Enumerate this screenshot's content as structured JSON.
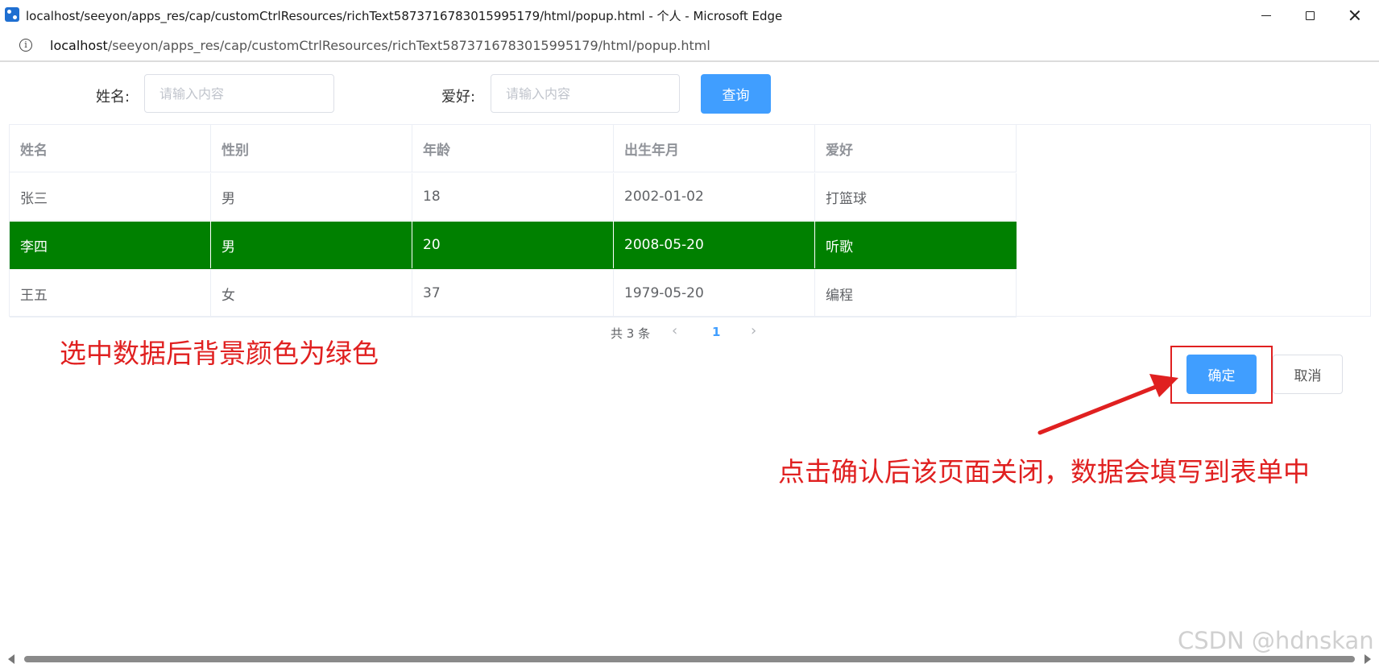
{
  "window": {
    "title": "localhost/seeyon/apps_res/cap/customCtrlResources/richText5873716783015995179/html/popup.html - 个人 - Microsoft Edge"
  },
  "address": {
    "host": "localhost",
    "path": "/seeyon/apps_res/cap/customCtrlResources/richText5873716783015995179/html/popup.html"
  },
  "search": {
    "name_label": "姓名:",
    "name_placeholder": "请输入内容",
    "hobby_label": "爱好:",
    "hobby_placeholder": "请输入内容",
    "query_label": "查询"
  },
  "table": {
    "columns": [
      "姓名",
      "性别",
      "年龄",
      "出生年月",
      "爱好"
    ],
    "rows": [
      [
        "张三",
        "男",
        "18",
        "2002-01-02",
        "打篮球"
      ],
      [
        "李四",
        "男",
        "20",
        "2008-05-20",
        "听歌"
      ],
      [
        "王五",
        "女",
        "37",
        "1979-05-20",
        "编程"
      ]
    ],
    "selected_row_index": 1,
    "selected_color": "#008000"
  },
  "pagination": {
    "total_text": "共 3 条",
    "current_page": "1",
    "prev_icon": "chevron-left-icon",
    "next_icon": "chevron-right-icon"
  },
  "actions": {
    "confirm_label": "确定",
    "cancel_label": "取消"
  },
  "annotations": {
    "selected_note": "选中数据后背景颜色为绿色",
    "confirm_note": "点击确认后该页面关闭，数据会填写到表单中",
    "color": "#e02020"
  },
  "watermark": "CSDN @hdnskan",
  "colors": {
    "primary": "#409eff",
    "border": "#ebeef5"
  }
}
